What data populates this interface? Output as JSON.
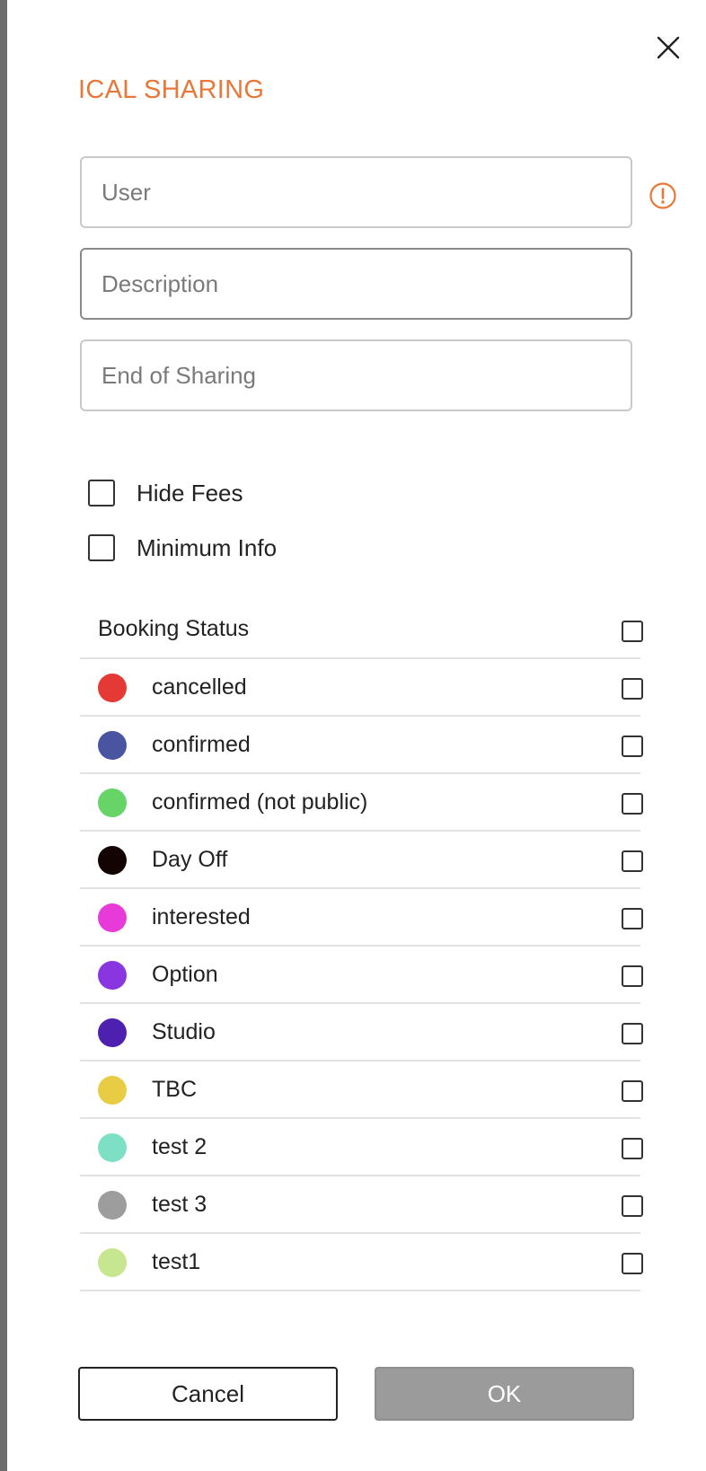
{
  "dialog": {
    "title": "ICAL SHARING",
    "close_icon": "close-icon"
  },
  "fields": {
    "user_placeholder": "User",
    "user_value": "",
    "description_placeholder": "Description",
    "description_value": "",
    "end_of_sharing_placeholder": "End of Sharing",
    "end_of_sharing_value": ""
  },
  "warning_icon": "alert-circle-icon",
  "options": [
    {
      "label": "Hide Fees",
      "checked": false
    },
    {
      "label": "Minimum Info",
      "checked": false
    }
  ],
  "booking_status": {
    "header": "Booking Status",
    "header_checked": false,
    "items": [
      {
        "label": "cancelled",
        "color": "#e53935",
        "checked": false
      },
      {
        "label": "confirmed",
        "color": "#4a55a2",
        "checked": false
      },
      {
        "label": "confirmed (not public)",
        "color": "#66d466",
        "checked": false
      },
      {
        "label": "Day Off",
        "color": "#130303",
        "checked": false
      },
      {
        "label": "interested",
        "color": "#e83ad8",
        "checked": false
      },
      {
        "label": "Option",
        "color": "#8a36e0",
        "checked": false
      },
      {
        "label": "Studio",
        "color": "#4e20b0",
        "checked": false
      },
      {
        "label": "TBC",
        "color": "#e8cc44",
        "checked": false
      },
      {
        "label": "test 2",
        "color": "#7ddfc4",
        "checked": false
      },
      {
        "label": "test 3",
        "color": "#9d9d9d",
        "checked": false
      },
      {
        "label": "test1",
        "color": "#c6e68f",
        "checked": false
      }
    ]
  },
  "buttons": {
    "cancel": "Cancel",
    "ok": "OK"
  },
  "colors": {
    "accent": "#e8773a",
    "ok_disabled": "#9b9b9b"
  }
}
